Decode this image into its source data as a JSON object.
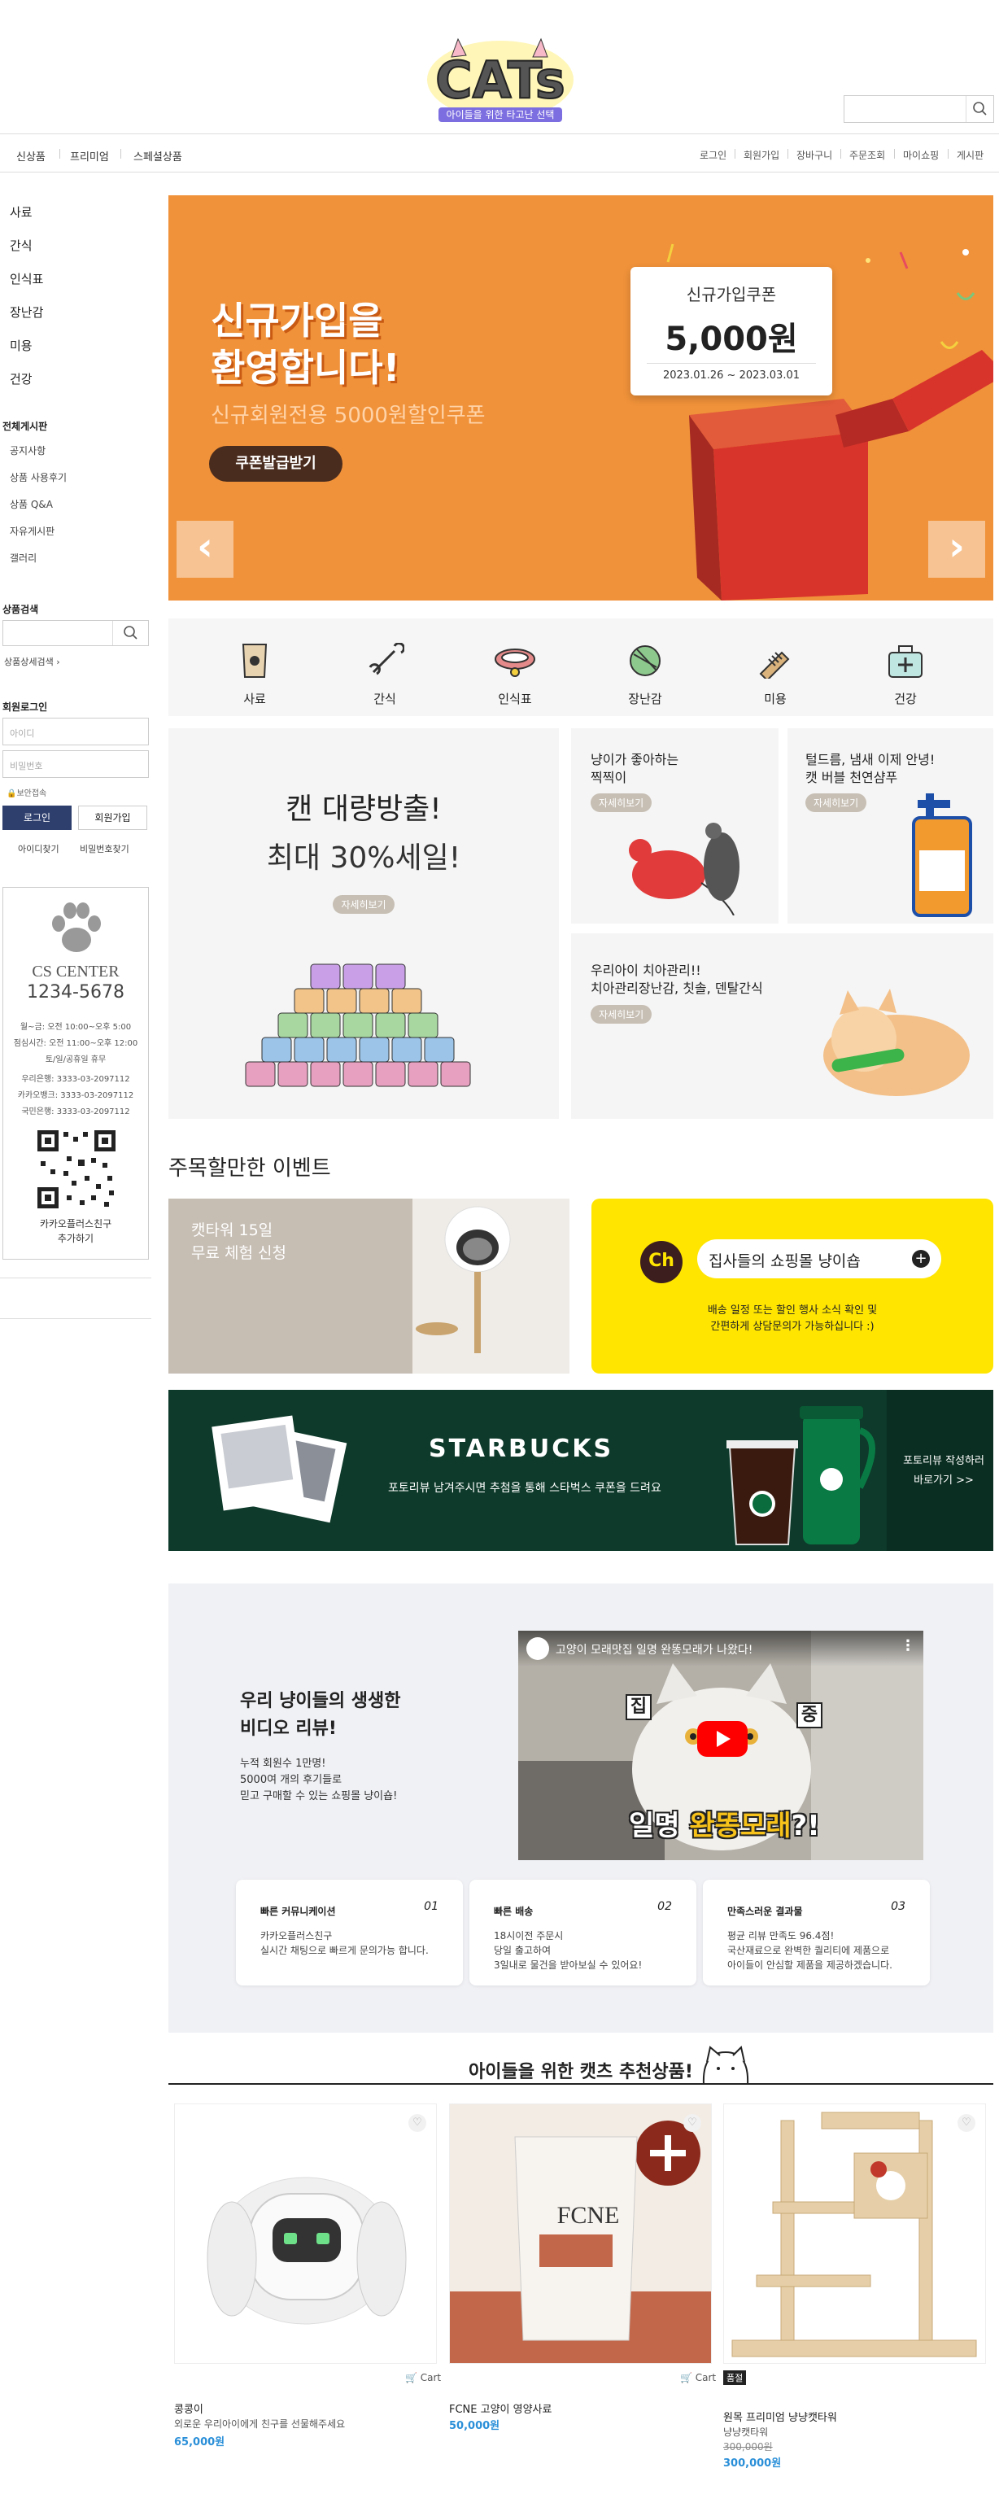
{
  "header": {
    "logo_text": "CATs",
    "logo_tagline": "아이들을 위한 타고난 선택",
    "search_placeholder": ""
  },
  "nav": {
    "left": [
      "신상품",
      "프리미엄",
      "스페셜상품"
    ],
    "right": [
      "로그인",
      "회원가입",
      "장바구니",
      "주문조회",
      "마이쇼핑",
      "게시판"
    ]
  },
  "sidebar": {
    "categories": [
      "사료",
      "간식",
      "인식표",
      "장난감",
      "미용",
      "건강"
    ],
    "board_title": "전체게시판",
    "boards": [
      "공지사항",
      "상품 사용후기",
      "상품 Q&A",
      "자유게시판",
      "갤러리"
    ],
    "search_title": "상품검색",
    "detail_search": "상품상세검색 ›",
    "login_title": "회원로그인",
    "id_placeholder": "아이디",
    "pw_placeholder": "비밀번호",
    "secure_login": "보안접속",
    "login_btn": "로그인",
    "join_btn": "회원가입",
    "find_id": "아이디찾기",
    "find_pw": "비밀번호찾기",
    "cs": {
      "title": "CS CENTER",
      "phone": "1234-5678",
      "hours": [
        "월~금: 오전 10:00~오후 5:00",
        "점심시간: 오전 11:00~오후 12:00",
        "토/일/공휴일 휴무"
      ],
      "banks": [
        "우리은행: 3333-03-2097112",
        "카카오뱅크: 3333-03-2097112",
        "국민은행: 3333-03-2097112"
      ],
      "kakao": "카카오플러스친구\n추가하기"
    }
  },
  "banner": {
    "line1": "신규가입을",
    "line2": "환영합니다!",
    "sub": "신규회원전용 5000원할인쿠폰",
    "button": "쿠폰발급받기",
    "coupon_title": "신규가입쿠폰",
    "coupon_amount": "5,000원",
    "coupon_period": "2023.01.26 ~ 2023.03.01",
    "prev": "‹",
    "next": "›"
  },
  "quick_cats": [
    "사료",
    "간식",
    "인식표",
    "장난감",
    "미용",
    "건강"
  ],
  "promos": {
    "can": {
      "title": "캔 대량방출!",
      "sub": "최대 30%세일!",
      "btn": "자세히보기"
    },
    "toy": {
      "title": "냥이가 좋아하는\n찍찍이",
      "btn": "자세히보기"
    },
    "bath": {
      "title": "털드름, 냄새 이제 안녕!\n캣 버블 천연샴푸",
      "btn": "자세히보기"
    },
    "dental": {
      "title": "우리아이 치아관리!!\n치아관리장난감, 칫솔, 덴탈간식",
      "btn": "자세히보기"
    }
  },
  "events": {
    "title": "주목할만한 이벤트",
    "cattower": "캣타워 15일\n무료 체험 신청",
    "chat_title": "집사들의 쇼핑몰 냥이숍",
    "chat_sub": "배송 일정 또는 할인 행사 소식 확인 및\n간편하게 상담문의가 가능하십니다 :)",
    "starbucks_title": "STARBUCKS",
    "starbucks_sub": "포토리뷰 남겨주시면 추첨을 통해 스타벅스 쿠폰을 드려요",
    "starbucks_cta": "포토리뷰 작성하러\n바로가기 >>"
  },
  "review": {
    "title": "우리 냥이들의 생생한\n비디오 리뷰!",
    "sub": "누적 회원수 1만명!\n5000여 개의 후기들로\n믿고 구매할 수 있는 쇼핑몰 냥이숍!",
    "video_title": "고양이 모래맛집 일명 완똥모래가 나왔다!",
    "video_caption_1": "일명 ",
    "video_caption_2": "완똥모래",
    "video_caption_3": "?!",
    "video_side_1": "집",
    "video_side_2": "중"
  },
  "features": [
    {
      "h": "빠른 커뮤니케이션",
      "n": "01",
      "d": "카카오플러스친구\n실시간 채팅으로 빠르게 문의가능 합니다."
    },
    {
      "h": "빠른 배송",
      "n": "02",
      "d": "18시이전 주문시\n당일 출고하여\n3일내로 물건을 받아보실 수 있어요!"
    },
    {
      "h": "만족스러운 결과물",
      "n": "03",
      "d": "평균 리뷰 만족도 96.4점!\n국산재료으로 완벽한 퀄리티에 제품으로\n아이들이 안심할 제품을 제공하겠습니다."
    }
  ],
  "recommend": {
    "title": "아이들을 위한 캣츠 추천상품!"
  },
  "products": [
    {
      "name": "콩콩이",
      "desc": "외로운 우리아이에게 친구를 선물해주세요",
      "price": "65,000원",
      "cart": "Cart",
      "brand": ""
    },
    {
      "name": "FCNE 고양이 영양사료",
      "desc": "",
      "price": "50,000원",
      "cart": "Cart",
      "brand": "FCNE"
    },
    {
      "name": "원목 프리미엄 냥냥캣타워",
      "desc": "냥냥캣타워",
      "old_price": "300,000원",
      "price": "300,000원",
      "badge": "품절"
    }
  ],
  "colors": {
    "banner_bg": "#f0923a",
    "accent_blue": "#2a8fd8",
    "kakao_yellow": "#ffe500",
    "starbucks_green": "#0d3a2a",
    "login_navy": "#2e3f6e"
  }
}
